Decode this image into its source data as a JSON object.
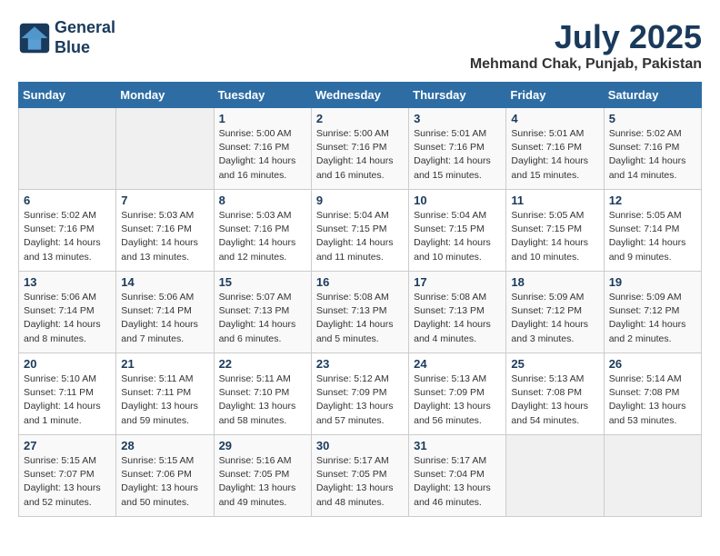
{
  "header": {
    "logo_line1": "General",
    "logo_line2": "Blue",
    "month": "July 2025",
    "location": "Mehmand Chak, Punjab, Pakistan"
  },
  "days_of_week": [
    "Sunday",
    "Monday",
    "Tuesday",
    "Wednesday",
    "Thursday",
    "Friday",
    "Saturday"
  ],
  "weeks": [
    [
      {
        "day": "",
        "info": ""
      },
      {
        "day": "",
        "info": ""
      },
      {
        "day": "1",
        "info": "Sunrise: 5:00 AM\nSunset: 7:16 PM\nDaylight: 14 hours\nand 16 minutes."
      },
      {
        "day": "2",
        "info": "Sunrise: 5:00 AM\nSunset: 7:16 PM\nDaylight: 14 hours\nand 16 minutes."
      },
      {
        "day": "3",
        "info": "Sunrise: 5:01 AM\nSunset: 7:16 PM\nDaylight: 14 hours\nand 15 minutes."
      },
      {
        "day": "4",
        "info": "Sunrise: 5:01 AM\nSunset: 7:16 PM\nDaylight: 14 hours\nand 15 minutes."
      },
      {
        "day": "5",
        "info": "Sunrise: 5:02 AM\nSunset: 7:16 PM\nDaylight: 14 hours\nand 14 minutes."
      }
    ],
    [
      {
        "day": "6",
        "info": "Sunrise: 5:02 AM\nSunset: 7:16 PM\nDaylight: 14 hours\nand 13 minutes."
      },
      {
        "day": "7",
        "info": "Sunrise: 5:03 AM\nSunset: 7:16 PM\nDaylight: 14 hours\nand 13 minutes."
      },
      {
        "day": "8",
        "info": "Sunrise: 5:03 AM\nSunset: 7:16 PM\nDaylight: 14 hours\nand 12 minutes."
      },
      {
        "day": "9",
        "info": "Sunrise: 5:04 AM\nSunset: 7:15 PM\nDaylight: 14 hours\nand 11 minutes."
      },
      {
        "day": "10",
        "info": "Sunrise: 5:04 AM\nSunset: 7:15 PM\nDaylight: 14 hours\nand 10 minutes."
      },
      {
        "day": "11",
        "info": "Sunrise: 5:05 AM\nSunset: 7:15 PM\nDaylight: 14 hours\nand 10 minutes."
      },
      {
        "day": "12",
        "info": "Sunrise: 5:05 AM\nSunset: 7:14 PM\nDaylight: 14 hours\nand 9 minutes."
      }
    ],
    [
      {
        "day": "13",
        "info": "Sunrise: 5:06 AM\nSunset: 7:14 PM\nDaylight: 14 hours\nand 8 minutes."
      },
      {
        "day": "14",
        "info": "Sunrise: 5:06 AM\nSunset: 7:14 PM\nDaylight: 14 hours\nand 7 minutes."
      },
      {
        "day": "15",
        "info": "Sunrise: 5:07 AM\nSunset: 7:13 PM\nDaylight: 14 hours\nand 6 minutes."
      },
      {
        "day": "16",
        "info": "Sunrise: 5:08 AM\nSunset: 7:13 PM\nDaylight: 14 hours\nand 5 minutes."
      },
      {
        "day": "17",
        "info": "Sunrise: 5:08 AM\nSunset: 7:13 PM\nDaylight: 14 hours\nand 4 minutes."
      },
      {
        "day": "18",
        "info": "Sunrise: 5:09 AM\nSunset: 7:12 PM\nDaylight: 14 hours\nand 3 minutes."
      },
      {
        "day": "19",
        "info": "Sunrise: 5:09 AM\nSunset: 7:12 PM\nDaylight: 14 hours\nand 2 minutes."
      }
    ],
    [
      {
        "day": "20",
        "info": "Sunrise: 5:10 AM\nSunset: 7:11 PM\nDaylight: 14 hours\nand 1 minute."
      },
      {
        "day": "21",
        "info": "Sunrise: 5:11 AM\nSunset: 7:11 PM\nDaylight: 13 hours\nand 59 minutes."
      },
      {
        "day": "22",
        "info": "Sunrise: 5:11 AM\nSunset: 7:10 PM\nDaylight: 13 hours\nand 58 minutes."
      },
      {
        "day": "23",
        "info": "Sunrise: 5:12 AM\nSunset: 7:09 PM\nDaylight: 13 hours\nand 57 minutes."
      },
      {
        "day": "24",
        "info": "Sunrise: 5:13 AM\nSunset: 7:09 PM\nDaylight: 13 hours\nand 56 minutes."
      },
      {
        "day": "25",
        "info": "Sunrise: 5:13 AM\nSunset: 7:08 PM\nDaylight: 13 hours\nand 54 minutes."
      },
      {
        "day": "26",
        "info": "Sunrise: 5:14 AM\nSunset: 7:08 PM\nDaylight: 13 hours\nand 53 minutes."
      }
    ],
    [
      {
        "day": "27",
        "info": "Sunrise: 5:15 AM\nSunset: 7:07 PM\nDaylight: 13 hours\nand 52 minutes."
      },
      {
        "day": "28",
        "info": "Sunrise: 5:15 AM\nSunset: 7:06 PM\nDaylight: 13 hours\nand 50 minutes."
      },
      {
        "day": "29",
        "info": "Sunrise: 5:16 AM\nSunset: 7:05 PM\nDaylight: 13 hours\nand 49 minutes."
      },
      {
        "day": "30",
        "info": "Sunrise: 5:17 AM\nSunset: 7:05 PM\nDaylight: 13 hours\nand 48 minutes."
      },
      {
        "day": "31",
        "info": "Sunrise: 5:17 AM\nSunset: 7:04 PM\nDaylight: 13 hours\nand 46 minutes."
      },
      {
        "day": "",
        "info": ""
      },
      {
        "day": "",
        "info": ""
      }
    ]
  ]
}
